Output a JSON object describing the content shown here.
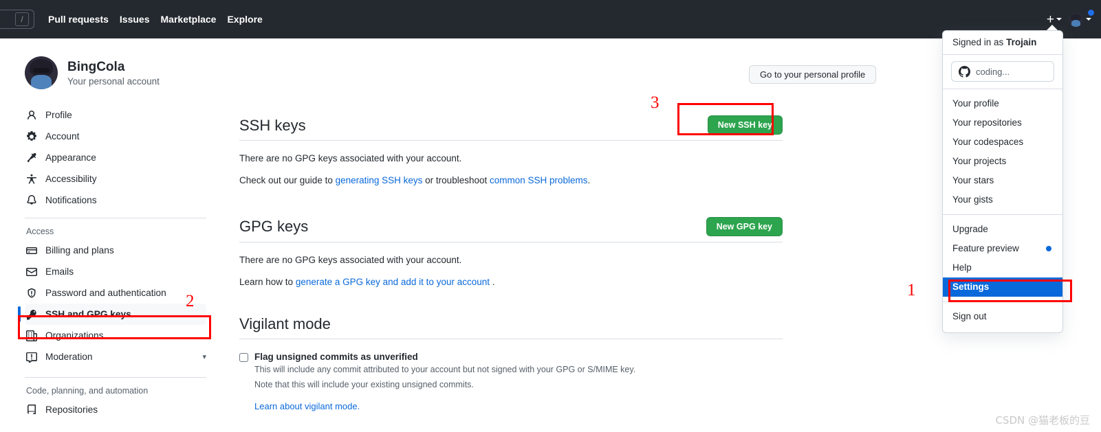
{
  "header": {
    "search_shortcut": "/",
    "nav": [
      {
        "label": "Pull requests"
      },
      {
        "label": "Issues"
      },
      {
        "label": "Marketplace"
      },
      {
        "label": "Explore"
      }
    ],
    "create_new_label": "+"
  },
  "dropdown": {
    "signed_in_prefix": "Signed in as ",
    "username": "Trojain",
    "status_text": "coding...",
    "groups": [
      {
        "items": [
          {
            "label": "Your profile",
            "selected": false,
            "dot": false
          },
          {
            "label": "Your repositories",
            "selected": false,
            "dot": false
          },
          {
            "label": "Your codespaces",
            "selected": false,
            "dot": false
          },
          {
            "label": "Your projects",
            "selected": false,
            "dot": false
          },
          {
            "label": "Your stars",
            "selected": false,
            "dot": false
          },
          {
            "label": "Your gists",
            "selected": false,
            "dot": false
          }
        ]
      },
      {
        "items": [
          {
            "label": "Upgrade",
            "selected": false,
            "dot": false
          },
          {
            "label": "Feature preview",
            "selected": false,
            "dot": true
          },
          {
            "label": "Help",
            "selected": false,
            "dot": false
          },
          {
            "label": "Settings",
            "selected": true,
            "dot": false
          }
        ]
      },
      {
        "items": [
          {
            "label": "Sign out",
            "selected": false,
            "dot": false
          }
        ]
      }
    ]
  },
  "sidebar": {
    "account_name": "BingCola",
    "account_subtitle": "Your personal account",
    "primary_items": [
      {
        "label": "Profile",
        "icon": "person-icon"
      },
      {
        "label": "Account",
        "icon": "gear-icon"
      },
      {
        "label": "Appearance",
        "icon": "paintbrush-icon"
      },
      {
        "label": "Accessibility",
        "icon": "accessibility-icon"
      },
      {
        "label": "Notifications",
        "icon": "bell-icon"
      }
    ],
    "access_section_title": "Access",
    "access_items": [
      {
        "label": "Billing and plans",
        "icon": "credit-card-icon",
        "active": false,
        "chevron": false
      },
      {
        "label": "Emails",
        "icon": "mail-icon",
        "active": false,
        "chevron": false
      },
      {
        "label": "Password and authentication",
        "icon": "shield-icon",
        "active": false,
        "chevron": false
      },
      {
        "label": "SSH and GPG keys",
        "icon": "key-icon",
        "active": true,
        "chevron": false
      },
      {
        "label": "Organizations",
        "icon": "organization-icon",
        "active": false,
        "chevron": false
      },
      {
        "label": "Moderation",
        "icon": "report-icon",
        "active": false,
        "chevron": true
      }
    ],
    "code_section_title": "Code, planning, and automation",
    "code_items": [
      {
        "label": "Repositories",
        "icon": "repo-icon"
      }
    ]
  },
  "main": {
    "profile_button": "Go to your personal profile",
    "ssh": {
      "title": "SSH keys",
      "new_button": "New SSH key",
      "empty_text": "There are no GPG keys associated with your account.",
      "guide_prefix": "Check out our guide to ",
      "guide_link1": "generating SSH keys",
      "guide_middle": " or troubleshoot ",
      "guide_link2": "common SSH problems",
      "guide_suffix": "."
    },
    "gpg": {
      "title": "GPG keys",
      "new_button": "New GPG key",
      "empty_text": "There are no GPG keys associated with your account.",
      "learn_prefix": "Learn how to ",
      "learn_link": "generate a GPG key and add it to your account",
      "learn_suffix": " ."
    },
    "vigilant": {
      "title": "Vigilant mode",
      "checkbox_label": "Flag unsigned commits as unverified",
      "desc_line1": "This will include any commit attributed to your account but not signed with your GPG or S/MIME key.",
      "desc_line2": "Note that this will include your existing unsigned commits.",
      "learn_link": "Learn about vigilant mode."
    }
  },
  "annotations": {
    "step1": "1",
    "step2": "2",
    "step3": "3"
  },
  "watermark": "CSDN @猫老板的豆",
  "colors": {
    "header_bg": "#24292f",
    "green_button": "#2da44e",
    "link_blue": "#0969da",
    "annotation_red": "#ff0000",
    "selected_blue": "#0969da"
  }
}
